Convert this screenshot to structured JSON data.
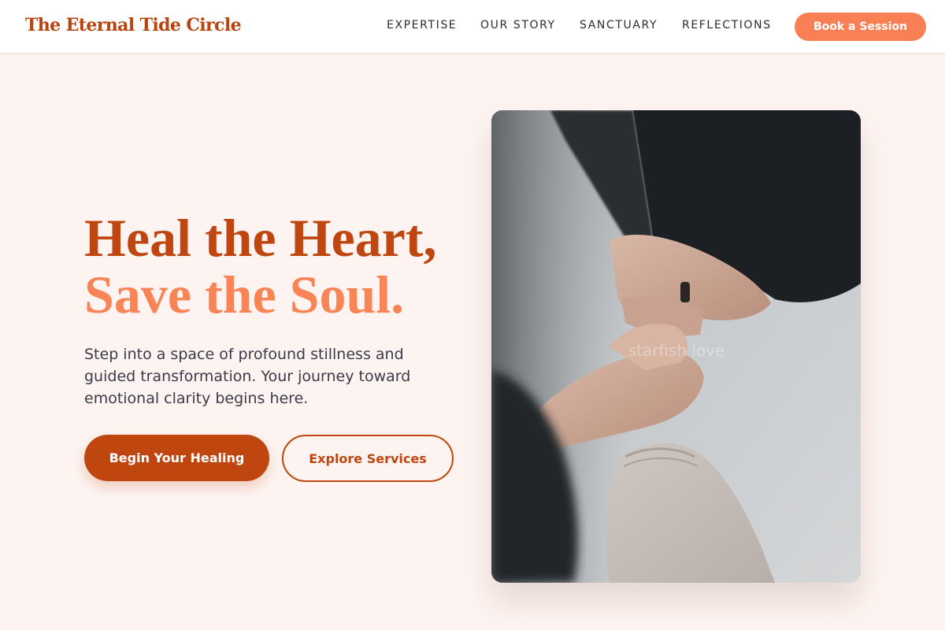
{
  "header": {
    "logo": "The Eternal Tide Circle",
    "nav": [
      "EXPERTISE",
      "OUR STORY",
      "SANCTUARY",
      "REFLECTIONS"
    ],
    "cta_label": "Book a Session"
  },
  "hero": {
    "headline_line1": "Heal the Heart,",
    "headline_line2": "Save the Soul.",
    "subtext": "Step into a space of profound stillness and guided transformation. Your journey toward emotional clarity begins here.",
    "primary_button": "Begin Your Healing",
    "secondary_button": "Explore Services",
    "image_watermark": "starfish love"
  },
  "colors": {
    "brand": "#c04610",
    "accent": "#f97f55",
    "background": "#fdf4f1"
  }
}
